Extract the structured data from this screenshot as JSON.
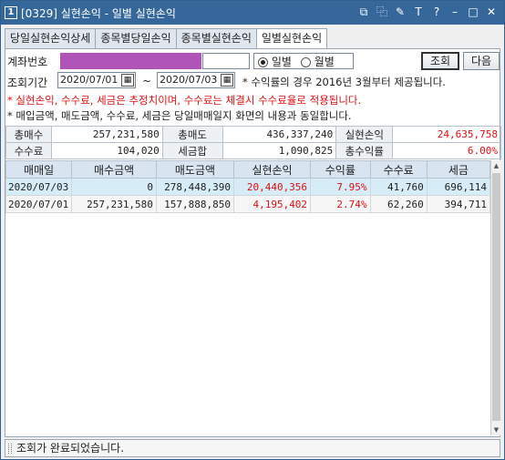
{
  "window": {
    "badge": "1",
    "title": "[0329] 실현손익 - 일별 실현손익",
    "controls": [
      "⧉",
      "⿻",
      "✎",
      "T",
      "?",
      "–",
      "□",
      "✕"
    ]
  },
  "tabs": [
    {
      "label": "당일실현손익상세"
    },
    {
      "label": "종목별당일손익"
    },
    {
      "label": "종목별실현손익"
    },
    {
      "label": "일별실현손익"
    }
  ],
  "form": {
    "account_label": "계좌번호",
    "period_label": "조회기간",
    "date_from": "2020/07/01",
    "tilde": "~",
    "date_to": "2020/07/03",
    "radio_daily": "일별",
    "radio_monthly": "월별",
    "query_button": "조회",
    "next_button": "다음",
    "rate_note": "* 수익률의 경우 2016년 3월부터 제공됩니다."
  },
  "notes": {
    "warning": "* 실현손익, 수수료, 세금은 추정치이며, 수수료는 체결시 수수료율로 적용됩니다.",
    "info": "* 매입금액, 매도금액, 수수료, 세금은 당일매매일지 화면의 내용과 동일합니다."
  },
  "summary": {
    "total_buy_label": "총매수",
    "total_buy": "257,231,580",
    "total_sell_label": "총매도",
    "total_sell": "436,337,240",
    "realized_label": "실현손익",
    "realized": "24,635,758",
    "fee_label": "수수료",
    "fee": "104,020",
    "tax_label": "세금합",
    "tax": "1,090,825",
    "total_rate_label": "총수익률",
    "total_rate": "6.00%"
  },
  "grid": {
    "columns": [
      "매매일",
      "매수금액",
      "매도금액",
      "실현손익",
      "수익률",
      "수수료",
      "세금"
    ],
    "rows": [
      [
        "2020/07/03",
        "0",
        "278,448,390",
        "20,440,356",
        "7.95%",
        "41,760",
        "696,114"
      ],
      [
        "2020/07/01",
        "257,231,580",
        "157,888,850",
        "4,195,402",
        "2.74%",
        "62,260",
        "394,711"
      ]
    ]
  },
  "status": {
    "message": "조회가 완료되었습니다."
  },
  "colors": {
    "title_bg": "#36679b",
    "positive": "#d11111",
    "mask": "#b154b8",
    "header_bg": "#d8e4ef",
    "selected_row": "#d6ecf7"
  }
}
